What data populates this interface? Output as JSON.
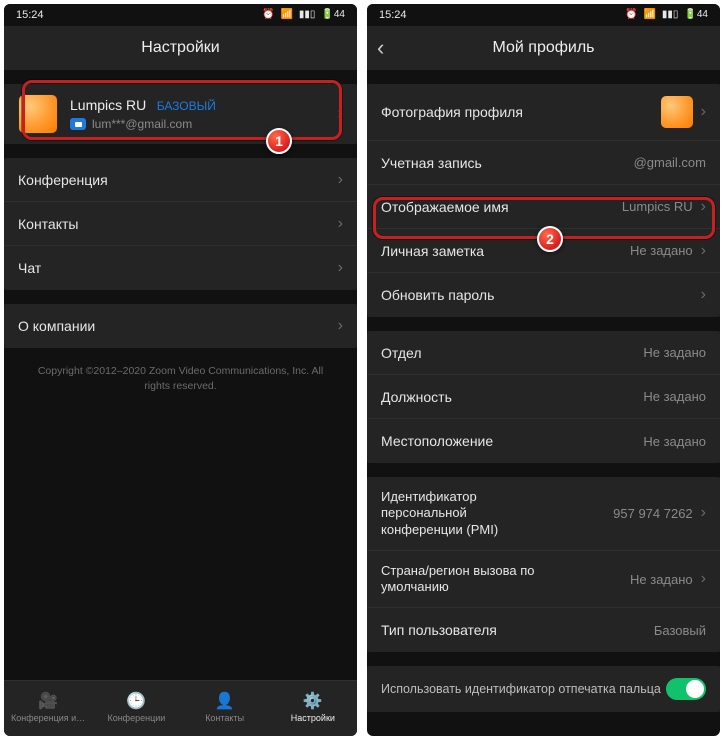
{
  "statusbar": {
    "time": "15:24",
    "battery": "44"
  },
  "left": {
    "title": "Настройки",
    "profile": {
      "name": "Lumpics RU",
      "badge": "БАЗОВЫЙ",
      "email": "lum***@gmail.com"
    },
    "rows": {
      "conference": "Конференция",
      "contacts": "Контакты",
      "chat": "Чат",
      "about": "О компании"
    },
    "copyright": "Copyright ©2012–2020 Zoom Video Communications, Inc. All rights reserved.",
    "tabs": {
      "t1": "Конференция и…",
      "t2": "Конференции",
      "t3": "Контакты",
      "t4": "Настройки"
    }
  },
  "right": {
    "title": "Мой профиль",
    "rows": {
      "photo": "Фотография профиля",
      "account_label": "Учетная запись",
      "account_value": "@gmail.com",
      "display_name_label": "Отображаемое имя",
      "display_name_value": "Lumpics RU",
      "note_label": "Личная заметка",
      "note_value": "Не задано",
      "update_password": "Обновить пароль",
      "department_label": "Отдел",
      "department_value": "Не задано",
      "position_label": "Должность",
      "position_value": "Не задано",
      "location_label": "Местоположение",
      "location_value": "Не задано",
      "pmi_label": "Идентификатор персональной конференции (PMI)",
      "pmi_value": "957 974 7262",
      "callregion_label": "Страна/регион вызова по умолчанию",
      "callregion_value": "Не задано",
      "usertype_label": "Тип пользователя",
      "usertype_value": "Базовый",
      "fingerprint": "Использовать идентификатор отпечатка пальца"
    }
  },
  "badges": {
    "one": "1",
    "two": "2"
  }
}
